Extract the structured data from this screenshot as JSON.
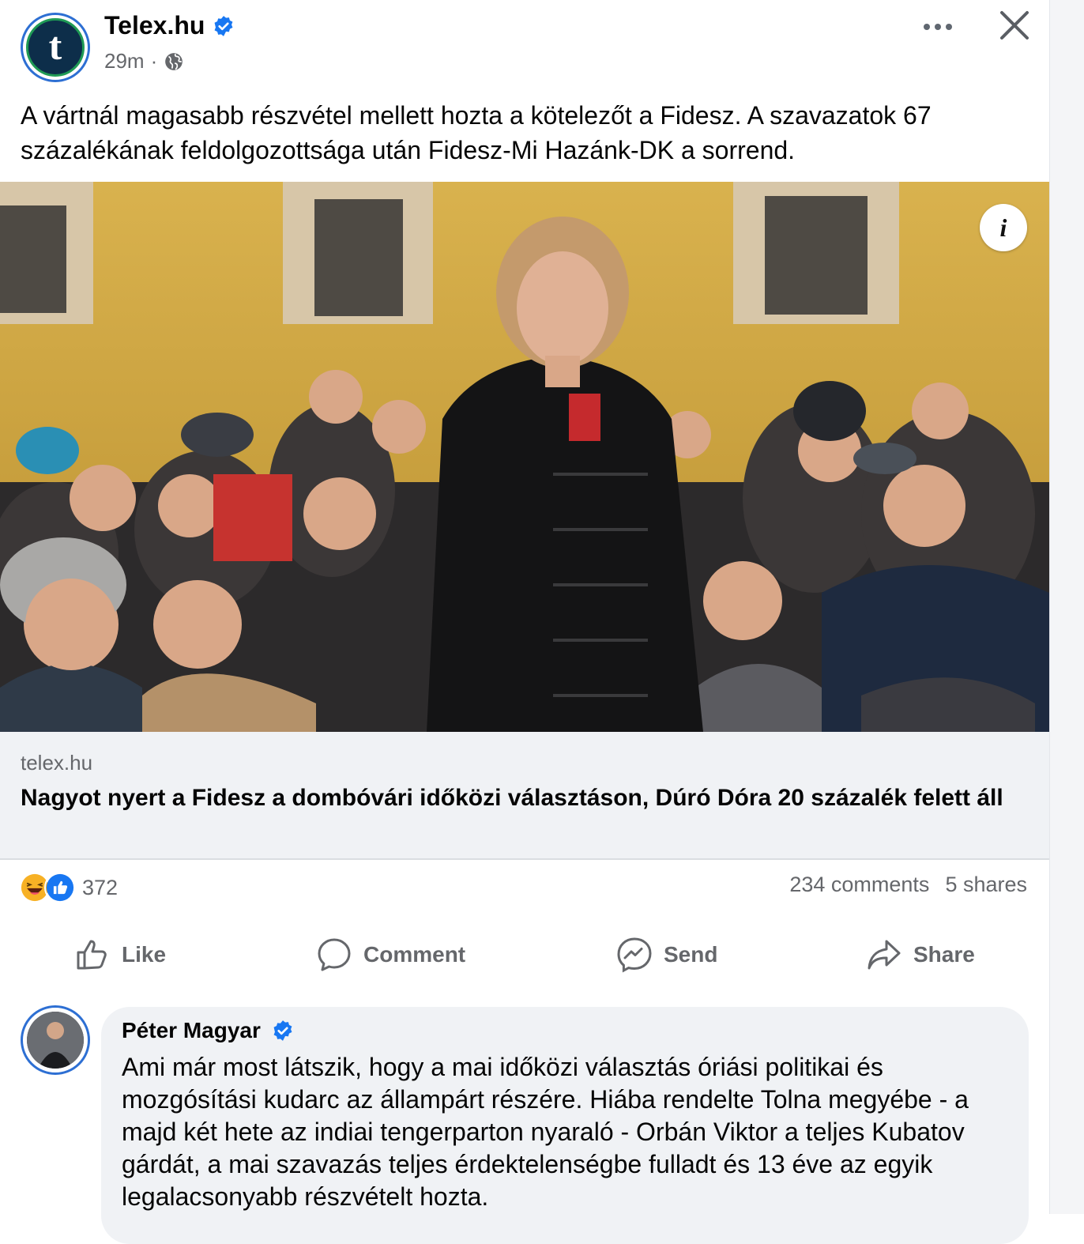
{
  "post": {
    "page_name": "Telex.hu",
    "avatar_letter": "t",
    "time": "29m",
    "separator": "·",
    "text": "A vártnál magasabb részvétel mellett hozta a kötelezőt a Fidesz. A szavazatok 67 százalékának feldolgozottsága után Fidesz-Mi Hazánk-DK a sorrend.",
    "info_label": "i"
  },
  "link": {
    "domain": "telex.hu",
    "title": "Nagyot nyert a Fidesz a dombóvári időközi választáson, Dúró Dóra 20 százalék felett áll"
  },
  "reactions": {
    "count": "372",
    "icons": [
      "haha-icon",
      "like-icon"
    ],
    "comments": "234 comments",
    "shares": "5 shares"
  },
  "actions": {
    "like": "Like",
    "comment": "Comment",
    "send": "Send",
    "share": "Share"
  },
  "comment": {
    "author": "Péter Magyar",
    "text": "Ami már most látszik, hogy a mai időközi választás óriási politikai és mozgósítási kudarc az állampárt részére. Hiába rendelte Tolna megyébe - a majd két hete az indiai tengerparton nyaraló - Orbán Viktor a teljes Kubatov gárdát, a mai szavazás teljes érdektelenségbe fulladt és 13 éve az egyik legalacsonyabb részvételt hozta."
  },
  "colors": {
    "verified": "#1877f2",
    "muted": "#65676b",
    "preview_bg": "#f0f2f5"
  }
}
